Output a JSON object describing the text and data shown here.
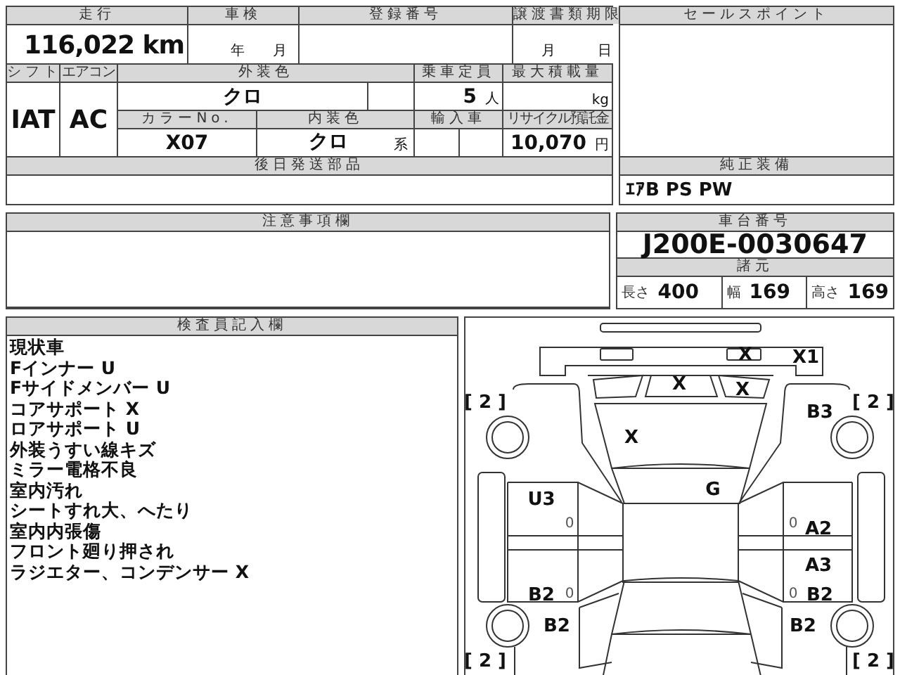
{
  "vehicle_sheet": {
    "row1_headers": [
      "走行",
      "車検",
      "登録番号",
      "譲渡書類期限"
    ],
    "mileage": "116,022 km",
    "inspection_year_unit": "年",
    "inspection_month_unit": "月",
    "transfer_month_unit": "月",
    "transfer_day_unit": "日",
    "shift_header": "シフト",
    "ac_header": "エアコン",
    "exterior_color_header": "外装色",
    "capacity_header": "乗車定員",
    "max_load_header": "最大積載量",
    "shift": "IAT",
    "ac": "AC",
    "exterior_color": "クロ",
    "capacity": "5",
    "capacity_unit": "人",
    "max_load_unit": "kg",
    "color_no_header": "カラーNo.",
    "interior_color_header": "内装色",
    "import_header": "輸入車",
    "recycle_header": "リサイクル預託金",
    "color_no": "X07",
    "interior_color": "クロ",
    "interior_color_suffix": "系",
    "recycle_fee": "10,070",
    "recycle_unit": "円",
    "later_parts_header": "後日発送部品"
  },
  "sales_points": {
    "title": "セールスポイント"
  },
  "standard_equipment": {
    "title": "純正装備",
    "value": "ｴｱB PS PW"
  },
  "notes": {
    "title": "注意事項欄"
  },
  "chassis": {
    "title": "車台番号",
    "number": "J200E-0030647",
    "specs_title": "諸元",
    "specs": [
      {
        "label": "長さ",
        "value": "400"
      },
      {
        "label": "幅",
        "value": "169"
      },
      {
        "label": "高さ",
        "value": "169"
      }
    ]
  },
  "inspector": {
    "title": "検査員記入欄",
    "lines": [
      "現状車",
      "Fインナー U",
      "Fサイドメンバー U",
      "コアサポート X",
      "ロアサポート U",
      "外装うすい線キズ",
      "ミラー電格不良",
      "室内汚れ",
      "シートすれ大、へたり",
      "室内内張傷",
      "フロント廻り押され",
      "ラジエター、コンデンサー X"
    ]
  },
  "damage_diagram": {
    "marks": [
      "X",
      "X1",
      "X",
      "X",
      "[ 2 ]",
      "[ 2 ]",
      "B3",
      "X",
      "G",
      "U3",
      "0",
      "0",
      "A2",
      "A3",
      "B2",
      "0",
      "0",
      "B2",
      "B2",
      "B2",
      "[ 2 ]",
      "[ 2 ]"
    ]
  }
}
